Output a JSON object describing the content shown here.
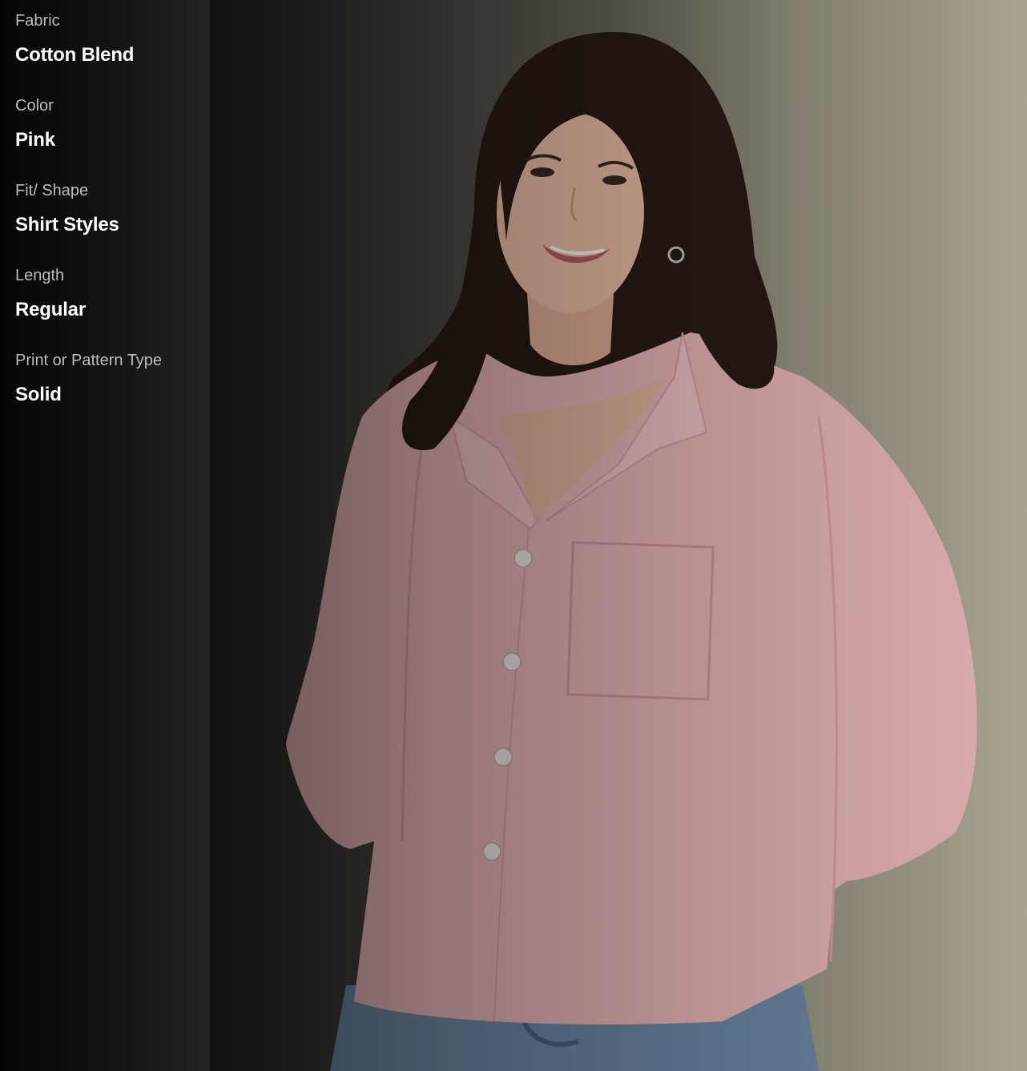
{
  "product": {
    "specs": [
      {
        "label": "Fabric",
        "value": "Cotton Blend"
      },
      {
        "label": "Color",
        "value": "Pink"
      },
      {
        "label": "Fit/ Shape",
        "value": "Shirt Styles"
      },
      {
        "label": "Length",
        "value": "Regular"
      },
      {
        "label": "Print or Pattern Type",
        "value": "Solid"
      }
    ]
  },
  "colors": {
    "panel_bg": "#0a0a0a",
    "label": "#bdbdbd",
    "value": "#ffffff",
    "shirt": "#e9b7b9",
    "hair": "#2a1b14",
    "denim": "#6e8aa6"
  }
}
